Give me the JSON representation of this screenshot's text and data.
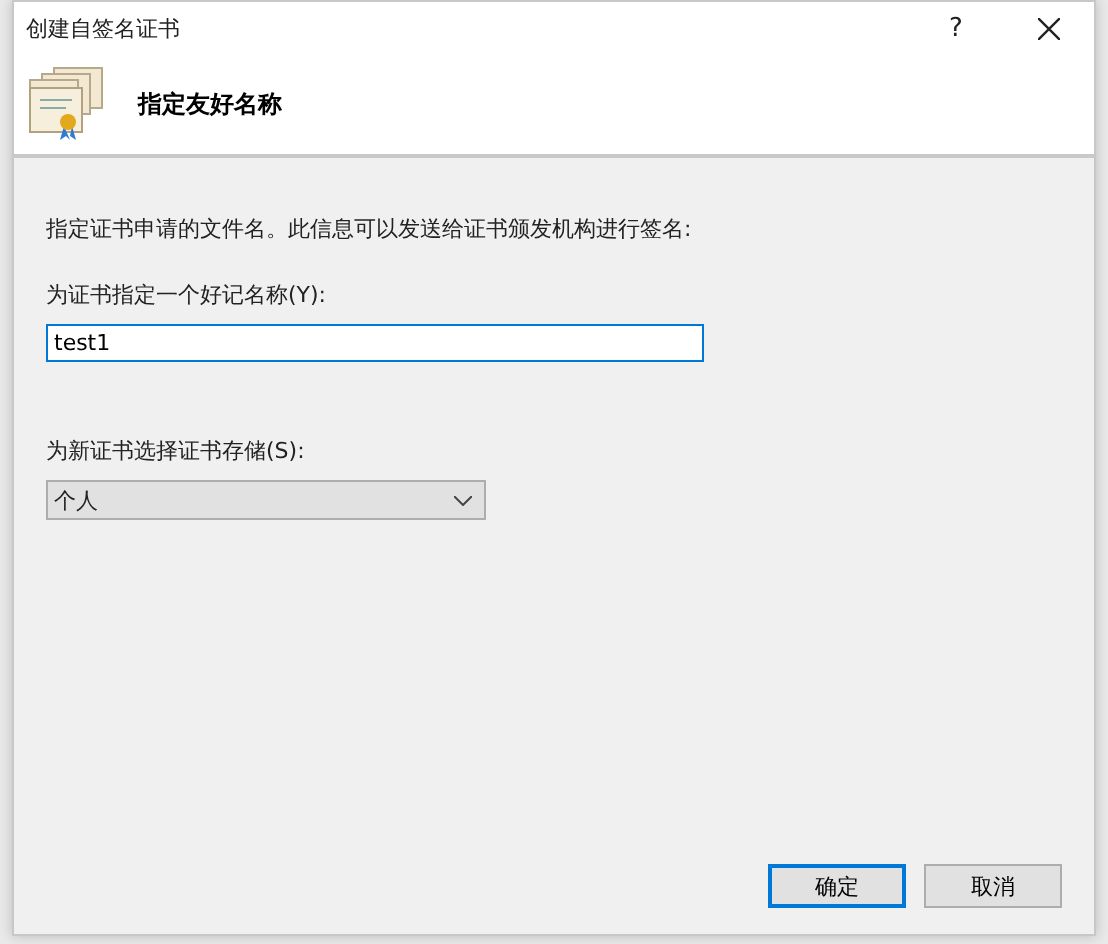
{
  "window": {
    "title": "创建自签名证书",
    "help": "?"
  },
  "header": {
    "title": "指定友好名称"
  },
  "description": "指定证书申请的文件名。此信息可以发送给证书颁发机构进行签名:",
  "name_field": {
    "label": "为证书指定一个好记名称(Y):",
    "value": "test1",
    "focused": true
  },
  "store_field": {
    "label": "为新证书选择证书存储(S):",
    "value": "个人"
  },
  "buttons": [
    {
      "label": "确定",
      "default": true
    },
    {
      "label": "取消",
      "default": false
    }
  ]
}
